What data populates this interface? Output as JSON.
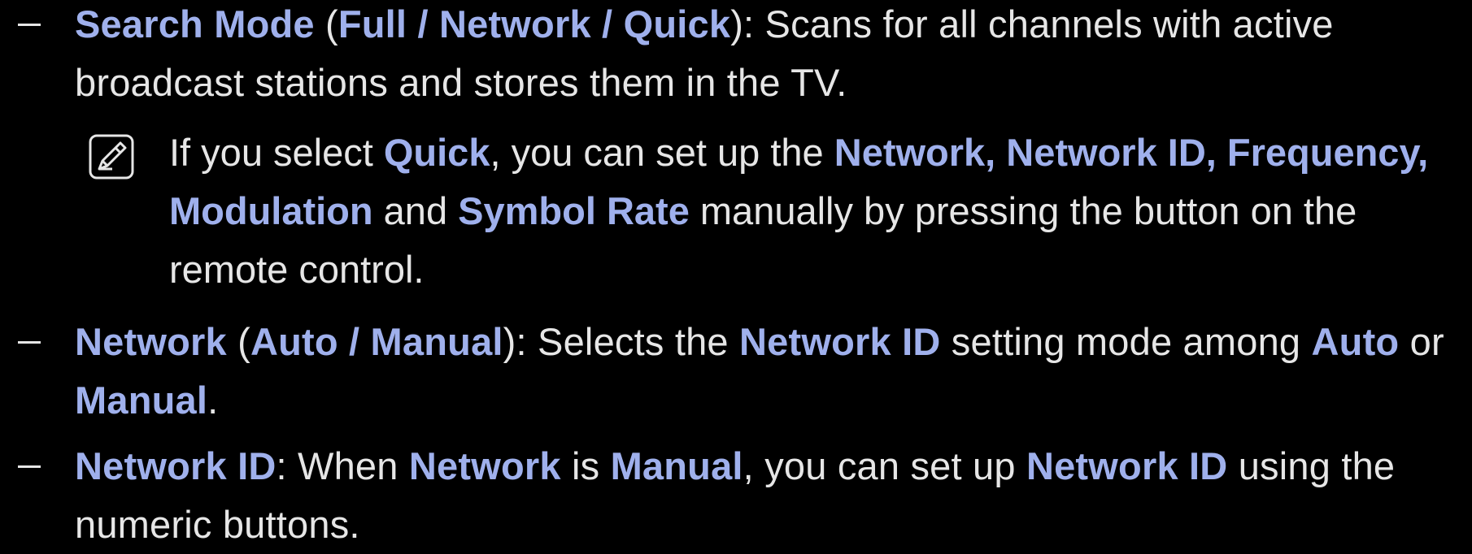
{
  "colors": {
    "background": "#000000",
    "text": "#e6e6e6",
    "highlight": "#9fb0ec"
  },
  "item1": {
    "t1": "Search Mode",
    "t2": " (",
    "t3": "Full / Network / Quick",
    "t4": "): Scans for all channels with active broadcast stations and stores them in the TV."
  },
  "note": {
    "icon": "note-pencil-icon",
    "t1": "If you select ",
    "t2": "Quick",
    "t3": ", you can set up the ",
    "t4": "Network, Network ID, Frequency, Modulation",
    "t5": " and ",
    "t6": "Symbol Rate",
    "t7": " manually by pressing the button on the remote control."
  },
  "item2": {
    "t1": "Network",
    "t2": " (",
    "t3": "Auto / Manual",
    "t4": "): Selects the ",
    "t5": "Network ID",
    "t6": " setting mode among ",
    "t7": "Auto",
    "t8": " or ",
    "t9": "Manual",
    "t10": "."
  },
  "item3": {
    "t1": "Network ID",
    "t2": ": When ",
    "t3": "Network",
    "t4": " is ",
    "t5": "Manual",
    "t6": ", you can set up ",
    "t7": "Network ID",
    "t8": " using the numeric buttons."
  }
}
